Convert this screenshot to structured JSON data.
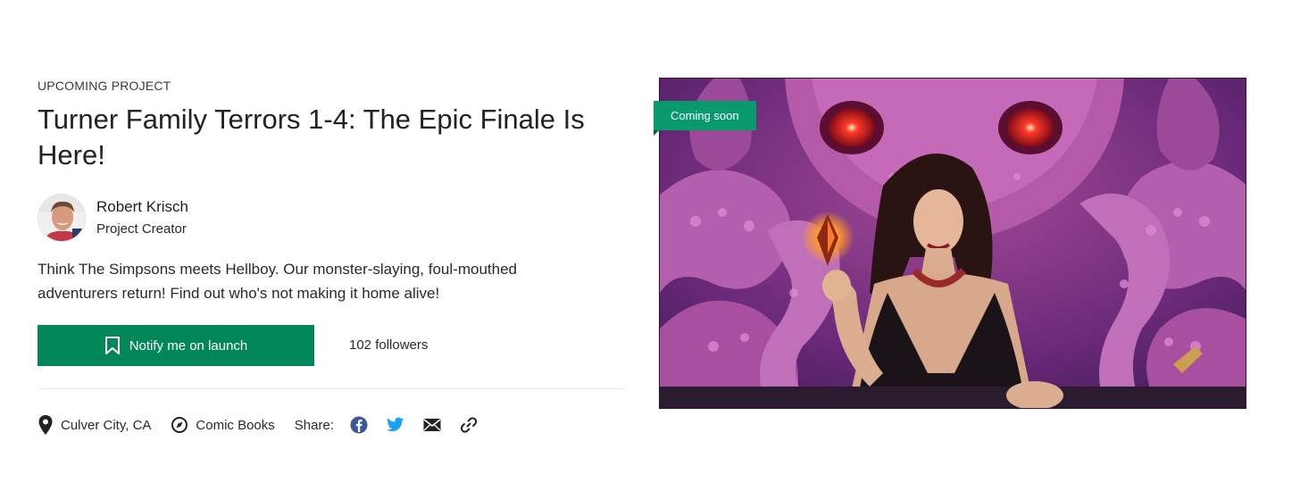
{
  "project": {
    "eyebrow": "UPCOMING PROJECT",
    "title": "Turner Family Terrors 1-4: The Epic Finale Is Here!",
    "blurb": "Think The Simpsons meets Hellboy. Our monster-slaying, foul-mouthed adventurers return! Find out who's not making it home alive!"
  },
  "creator": {
    "name": "Robert Krisch",
    "role": "Project Creator",
    "avatar_icon": "avatar-photo"
  },
  "actions": {
    "notify_label": "Notify me on launch",
    "notify_icon": "bookmark-icon",
    "followers": "102 followers"
  },
  "meta": {
    "location": "Culver City, CA",
    "location_icon": "location-pin-icon",
    "category": "Comic Books",
    "category_icon": "compass-icon",
    "share_label": "Share:",
    "share_icons": [
      "facebook-icon",
      "twitter-icon",
      "email-icon",
      "link-icon"
    ]
  },
  "hero": {
    "badge": "Coming soon",
    "image": "comic-cover-art"
  },
  "colors": {
    "accent_green": "#028858",
    "badge_green": "#089a6a",
    "facebook": "#3b5998",
    "twitter": "#1da1f2"
  }
}
